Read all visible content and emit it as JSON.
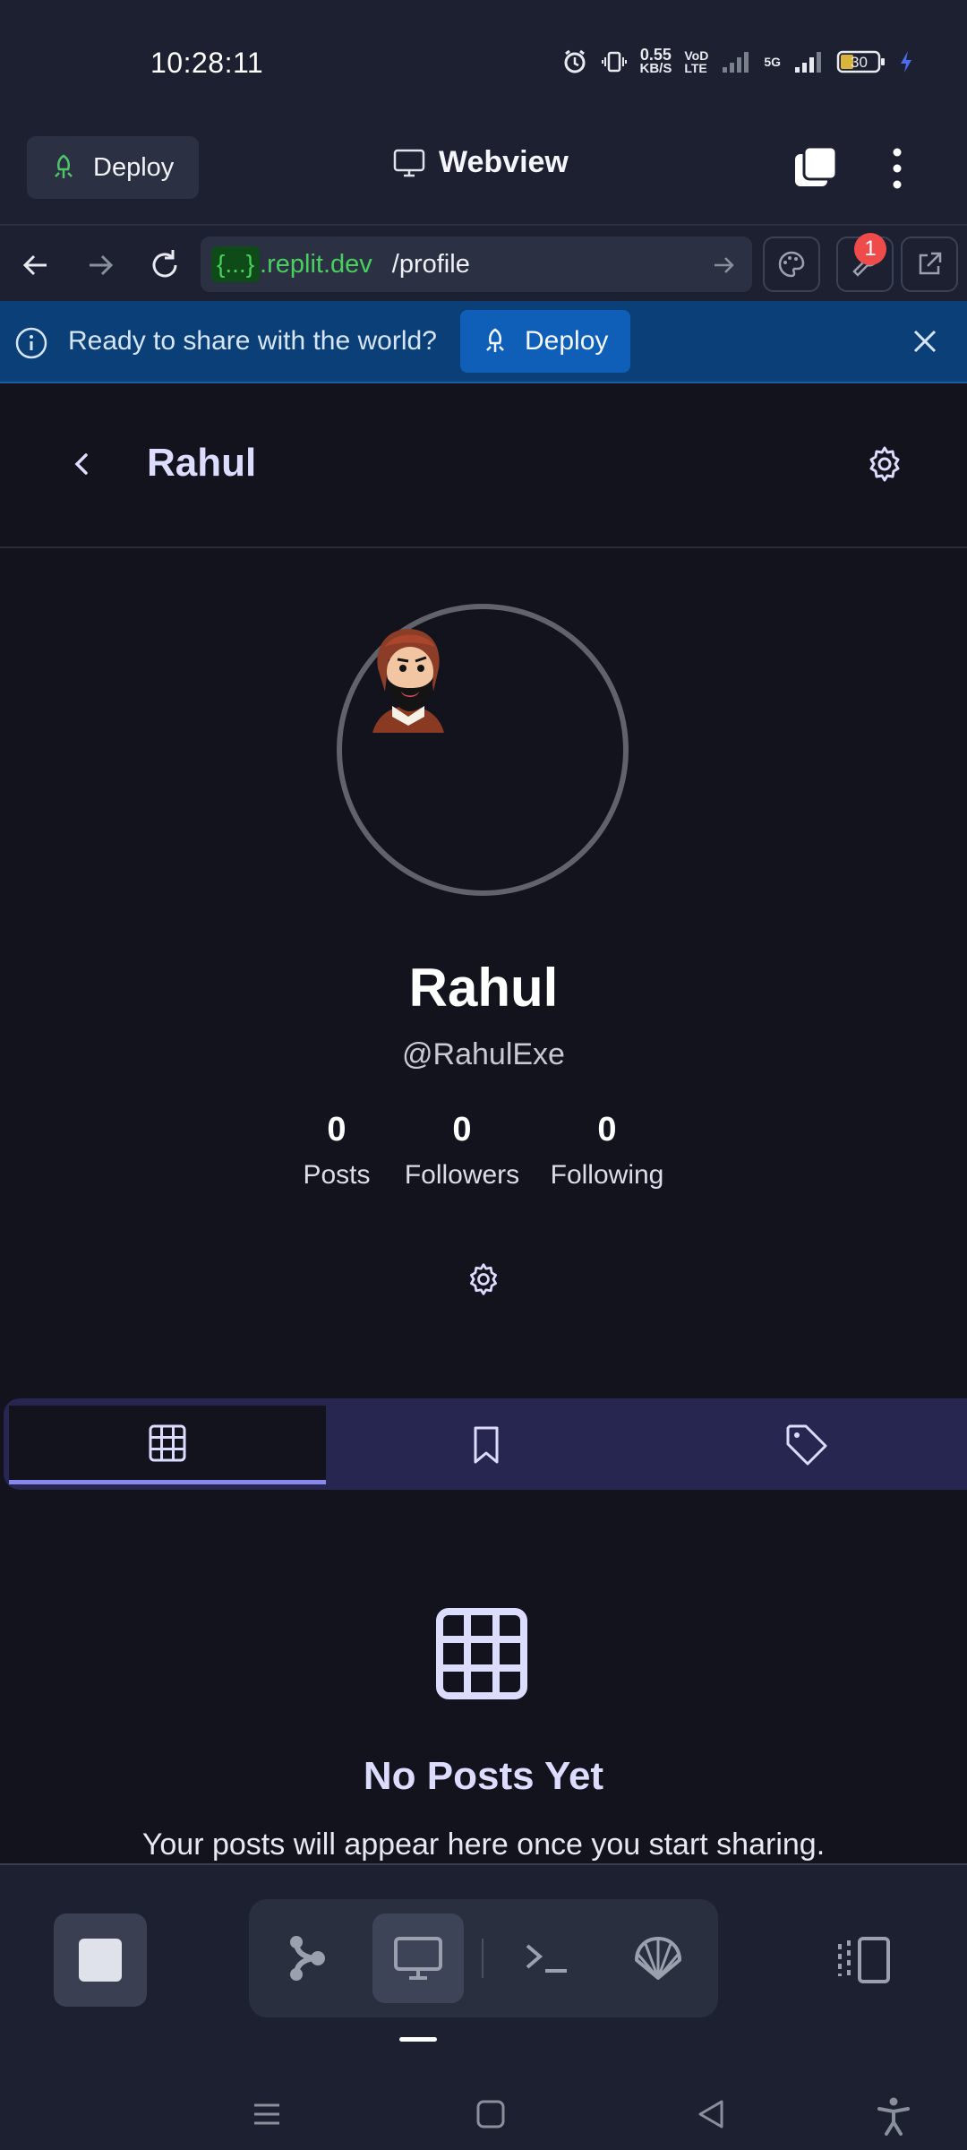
{
  "status_bar": {
    "time": "10:28:11",
    "net_speed_value": "0.55",
    "net_speed_unit": "KB/S",
    "volte_top": "VoD",
    "volte_bottom": "LTE",
    "signal_tag": "5G",
    "battery_level": "30"
  },
  "toolbar": {
    "deploy_label": "Deploy",
    "title": "Webview"
  },
  "url_bar": {
    "braces": "{...}",
    "host": ".replit.dev",
    "path": "/profile",
    "notification_count": "1"
  },
  "banner": {
    "message": "Ready to share with the world?",
    "deploy_label": "Deploy"
  },
  "app": {
    "header_title": "Rahul",
    "profile": {
      "name": "Rahul",
      "handle": "@RahulExe"
    },
    "stats": [
      {
        "value": "0",
        "label": "Posts"
      },
      {
        "value": "0",
        "label": "Followers"
      },
      {
        "value": "0",
        "label": "Following"
      }
    ],
    "empty_state": {
      "title": "No Posts Yet",
      "subtitle": "Your posts will appear here once you start sharing."
    }
  },
  "colors": {
    "accent": "#8787ec",
    "app_background": "#13131d",
    "tab_bar": "#262651",
    "banner": "#0b3f78",
    "url_host": "#48d05e"
  }
}
